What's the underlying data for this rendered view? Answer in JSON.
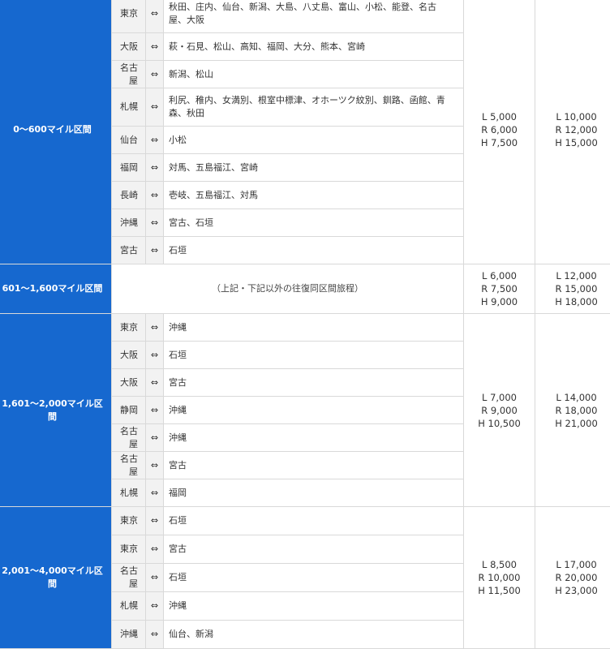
{
  "table": {
    "arrow": "⇔",
    "bands": [
      {
        "label": "0〜600マイル区間",
        "miles_a": [
          "L 5,000",
          "R 6,000",
          "H 7,500"
        ],
        "miles_b": [
          "L 10,000",
          "R 12,000",
          "H 15,000"
        ],
        "routes": [
          {
            "origin": "東京",
            "dest": "秋田、庄内、仙台、新潟、大島、八丈島、富山、小松、能登、名古屋、大阪"
          },
          {
            "origin": "大阪",
            "dest": "萩・石見、松山、高知、福岡、大分、熊本、宮崎"
          },
          {
            "origin": "名古屋",
            "dest": "新潟、松山"
          },
          {
            "origin": "札幌",
            "dest": "利尻、稚内、女満別、根室中標津、オホーツク紋別、釧路、函館、青森、秋田"
          },
          {
            "origin": "仙台",
            "dest": "小松"
          },
          {
            "origin": "福岡",
            "dest": "対馬、五島福江、宮崎"
          },
          {
            "origin": "長崎",
            "dest": "壱岐、五島福江、対馬"
          },
          {
            "origin": "沖縄",
            "dest": "宮古、石垣"
          },
          {
            "origin": "宮古",
            "dest": "石垣"
          }
        ]
      },
      {
        "label": "601〜1,600マイル区間",
        "other_text": "（上記・下記以外の往復同区間旅程）",
        "miles_a": [
          "L 6,000",
          "R 7,500",
          "H 9,000"
        ],
        "miles_b": [
          "L 12,000",
          "R 15,000",
          "H 18,000"
        ]
      },
      {
        "label": "1,601〜2,000マイル区間",
        "miles_a": [
          "L 7,000",
          "R 9,000",
          "H 10,500"
        ],
        "miles_b": [
          "L 14,000",
          "R 18,000",
          "H 21,000"
        ],
        "routes": [
          {
            "origin": "東京",
            "dest": "沖縄"
          },
          {
            "origin": "大阪",
            "dest": "石垣"
          },
          {
            "origin": "大阪",
            "dest": "宮古"
          },
          {
            "origin": "静岡",
            "dest": "沖縄"
          },
          {
            "origin": "名古屋",
            "dest": "沖縄"
          },
          {
            "origin": "名古屋",
            "dest": "宮古"
          },
          {
            "origin": "札幌",
            "dest": "福岡"
          }
        ]
      },
      {
        "label": "2,001〜4,000マイル区間",
        "miles_a": [
          "L 8,500",
          "R 10,000",
          "H 11,500"
        ],
        "miles_b": [
          "L 17,000",
          "R 20,000",
          "H 23,000"
        ],
        "routes": [
          {
            "origin": "東京",
            "dest": "石垣"
          },
          {
            "origin": "東京",
            "dest": "宮古"
          },
          {
            "origin": "名古屋",
            "dest": "石垣"
          },
          {
            "origin": "札幌",
            "dest": "沖縄"
          },
          {
            "origin": "沖縄",
            "dest": "仙台、新潟"
          }
        ]
      }
    ]
  }
}
